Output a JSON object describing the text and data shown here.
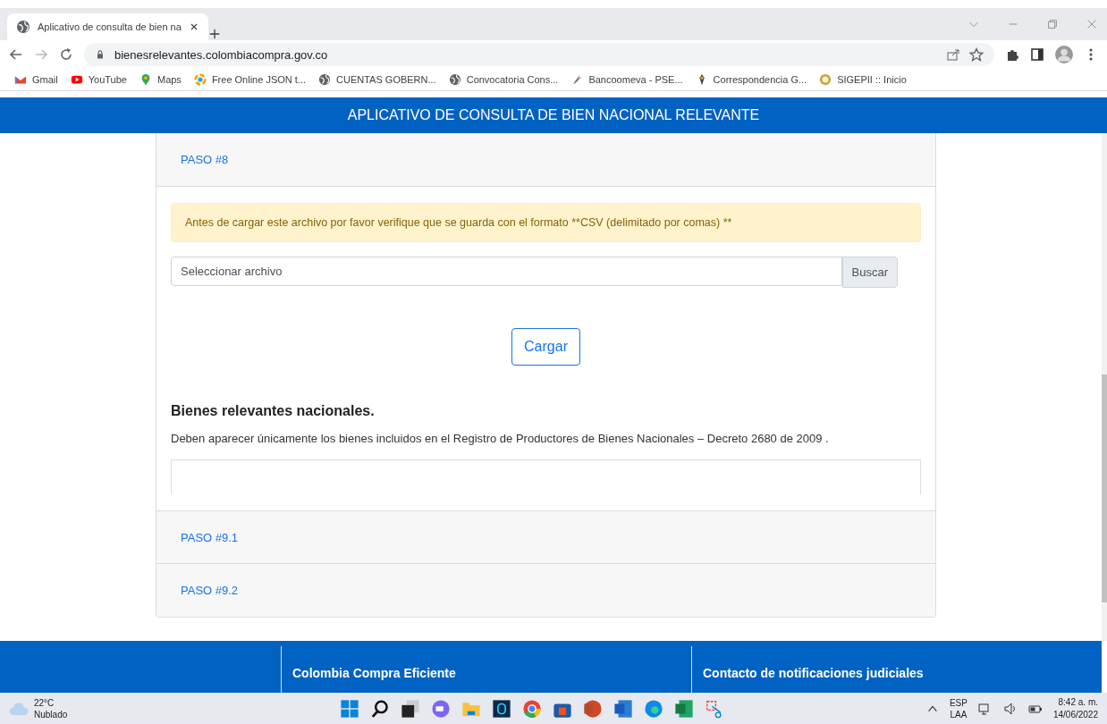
{
  "browser": {
    "tab_title": "Aplicativo de consulta de bien na",
    "address": "bienesrelevantes.colombiacompra.gov.co",
    "bookmarks": [
      {
        "label": "Gmail",
        "kind": "mail"
      },
      {
        "label": "YouTube",
        "kind": "video"
      },
      {
        "label": "Maps",
        "kind": "pin"
      },
      {
        "label": "Free Online JSON t...",
        "kind": "swirl"
      },
      {
        "label": "CUENTAS GOBERN...",
        "kind": "globe"
      },
      {
        "label": "Convocatoria Cons...",
        "kind": "globe"
      },
      {
        "label": "Bancoomeva - PSE...",
        "kind": "feather"
      },
      {
        "label": "Correspondencia G...",
        "kind": "emblem"
      },
      {
        "label": "SIGEPII :: Inicio",
        "kind": "seal"
      }
    ]
  },
  "header": {
    "title": "APLICATIVO DE CONSULTA DE BIEN NACIONAL RELEVANTE"
  },
  "steps": [
    {
      "label": "PASO #8",
      "expanded": true,
      "alert": "Antes de cargar este archivo por favor verifique que se guarda con el formato **CSV (delimitado por comas) **",
      "file_input": {
        "placeholder": "Seleccionar archivo",
        "browse": "Buscar"
      },
      "upload_button": "Cargar",
      "heading": "Bienes relevantes nacionales.",
      "paragraph": "Deben aparecer únicamente los bienes incluidos en el Registro de Productores de Bienes Nacionales – Decreto 2680 de 2009 ."
    },
    {
      "label": "PASO #9.1",
      "expanded": false
    },
    {
      "label": "PASO #9.2",
      "expanded": false
    }
  ],
  "footer": {
    "columns": [
      "Colombia Compra Eficiente",
      "Contacto de notificaciones judiciales"
    ]
  },
  "taskbar": {
    "temperature": "22°C",
    "weather": "Nublado",
    "language": "ESP",
    "layout": "LAA",
    "time": "8:42 a. m.",
    "date": "14/06/2022"
  }
}
